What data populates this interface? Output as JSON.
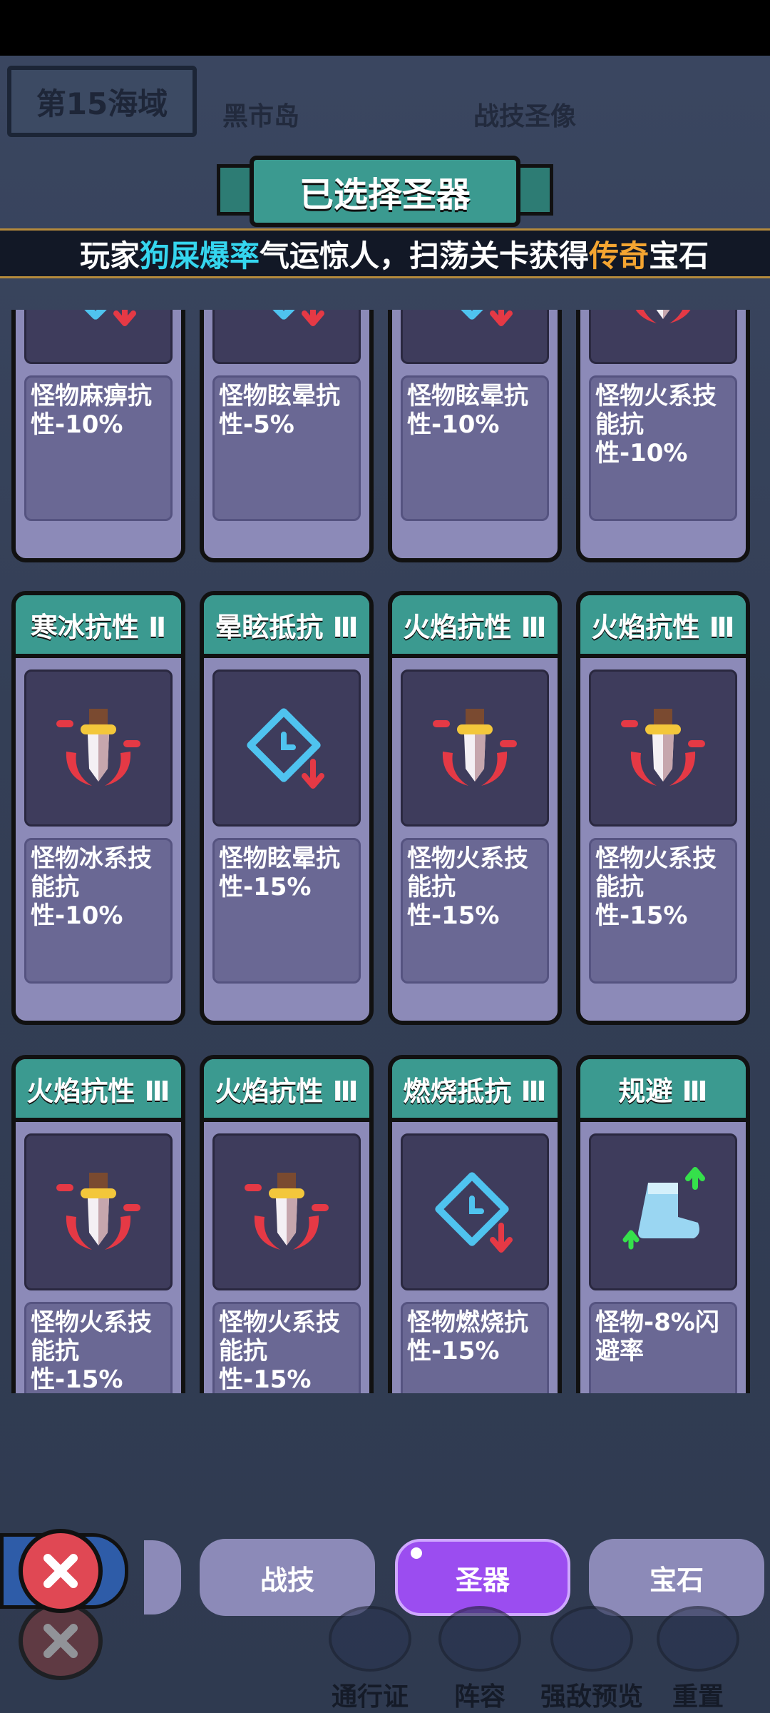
{
  "header": {
    "sea_zone": "第15海域",
    "map_labels": [
      "黑市岛",
      "战技圣像"
    ],
    "panel_title": "已选择圣器"
  },
  "ticker": {
    "prefix": "玩家",
    "highlight1": "狗屎爆率",
    "middle": "气运惊人，扫荡关卡获得",
    "highlight2": "传奇",
    "suffix": "宝石"
  },
  "cards": [
    {
      "title": "",
      "desc": "怪物麻痹抗性-10%",
      "icon": "stun-diamond-icon"
    },
    {
      "title": "",
      "desc": "怪物眩晕抗性-5%",
      "icon": "stun-diamond-icon"
    },
    {
      "title": "",
      "desc": "怪物眩晕抗性-10%",
      "icon": "stun-diamond-icon"
    },
    {
      "title": "",
      "desc": "怪物火系技能抗性-10%",
      "icon": "fire-dagger-icon"
    },
    {
      "title": "寒冰抗性 Ⅱ",
      "desc": "怪物冰系技能抗性-10%",
      "icon": "fire-dagger-icon"
    },
    {
      "title": "晕眩抵抗 Ⅲ",
      "desc": "怪物眩晕抗性-15%",
      "icon": "stun-diamond-icon"
    },
    {
      "title": "火焰抗性 Ⅲ",
      "desc": "怪物火系技能抗性-15%",
      "icon": "fire-dagger-icon"
    },
    {
      "title": "火焰抗性 Ⅲ",
      "desc": "怪物火系技能抗性-15%",
      "icon": "fire-dagger-icon"
    },
    {
      "title": "火焰抗性 Ⅲ",
      "desc": "怪物火系技能抗性-15%",
      "icon": "fire-dagger-icon"
    },
    {
      "title": "火焰抗性 Ⅲ",
      "desc": "怪物火系技能抗性-15%",
      "icon": "fire-dagger-icon"
    },
    {
      "title": "燃烧抵抗 Ⅲ",
      "desc": "怪物燃烧抗性-15%",
      "icon": "stun-diamond-icon"
    },
    {
      "title": "规避 Ⅲ",
      "desc": "怪物-8%闪避率",
      "icon": "boot-icon"
    }
  ],
  "tabs": [
    {
      "label": "战技"
    },
    {
      "label": "圣器",
      "active": true
    },
    {
      "label": "宝石"
    }
  ],
  "bottom_nav": [
    {
      "label": "通行证"
    },
    {
      "label": "阵容"
    },
    {
      "label": "强敌预览"
    },
    {
      "label": "重置"
    }
  ],
  "colors": {
    "card_header": "#3b9a90",
    "card_body": "#8c8ab8",
    "active_tab": "#9b4df0",
    "highlight_cyan": "#35d6ef",
    "highlight_orange": "#f5a531"
  }
}
